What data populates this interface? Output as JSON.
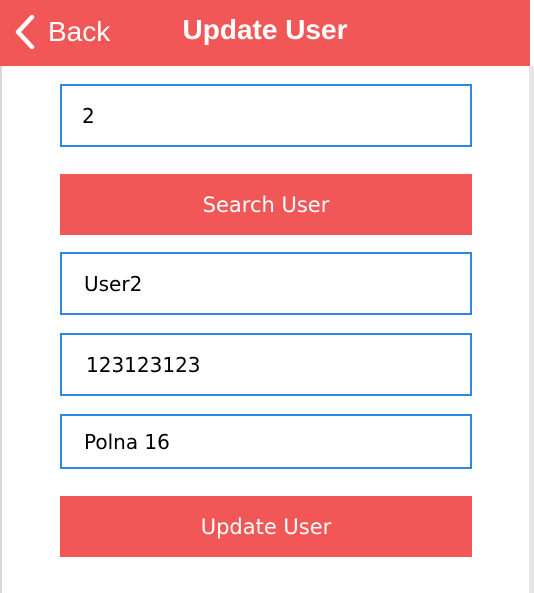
{
  "header": {
    "back_label": "Back",
    "title": "Update User"
  },
  "form": {
    "user_id_value": "2",
    "search_button_label": "Search User",
    "name_value": "User2",
    "phone_value": "123123123",
    "address_value": "Polna 16",
    "update_button_label": "Update User"
  },
  "icons": {
    "back": "chevron-left-icon"
  },
  "colors": {
    "accent": "#f25757",
    "field_border": "#2e86e6",
    "text_on_accent": "#ffffff"
  }
}
